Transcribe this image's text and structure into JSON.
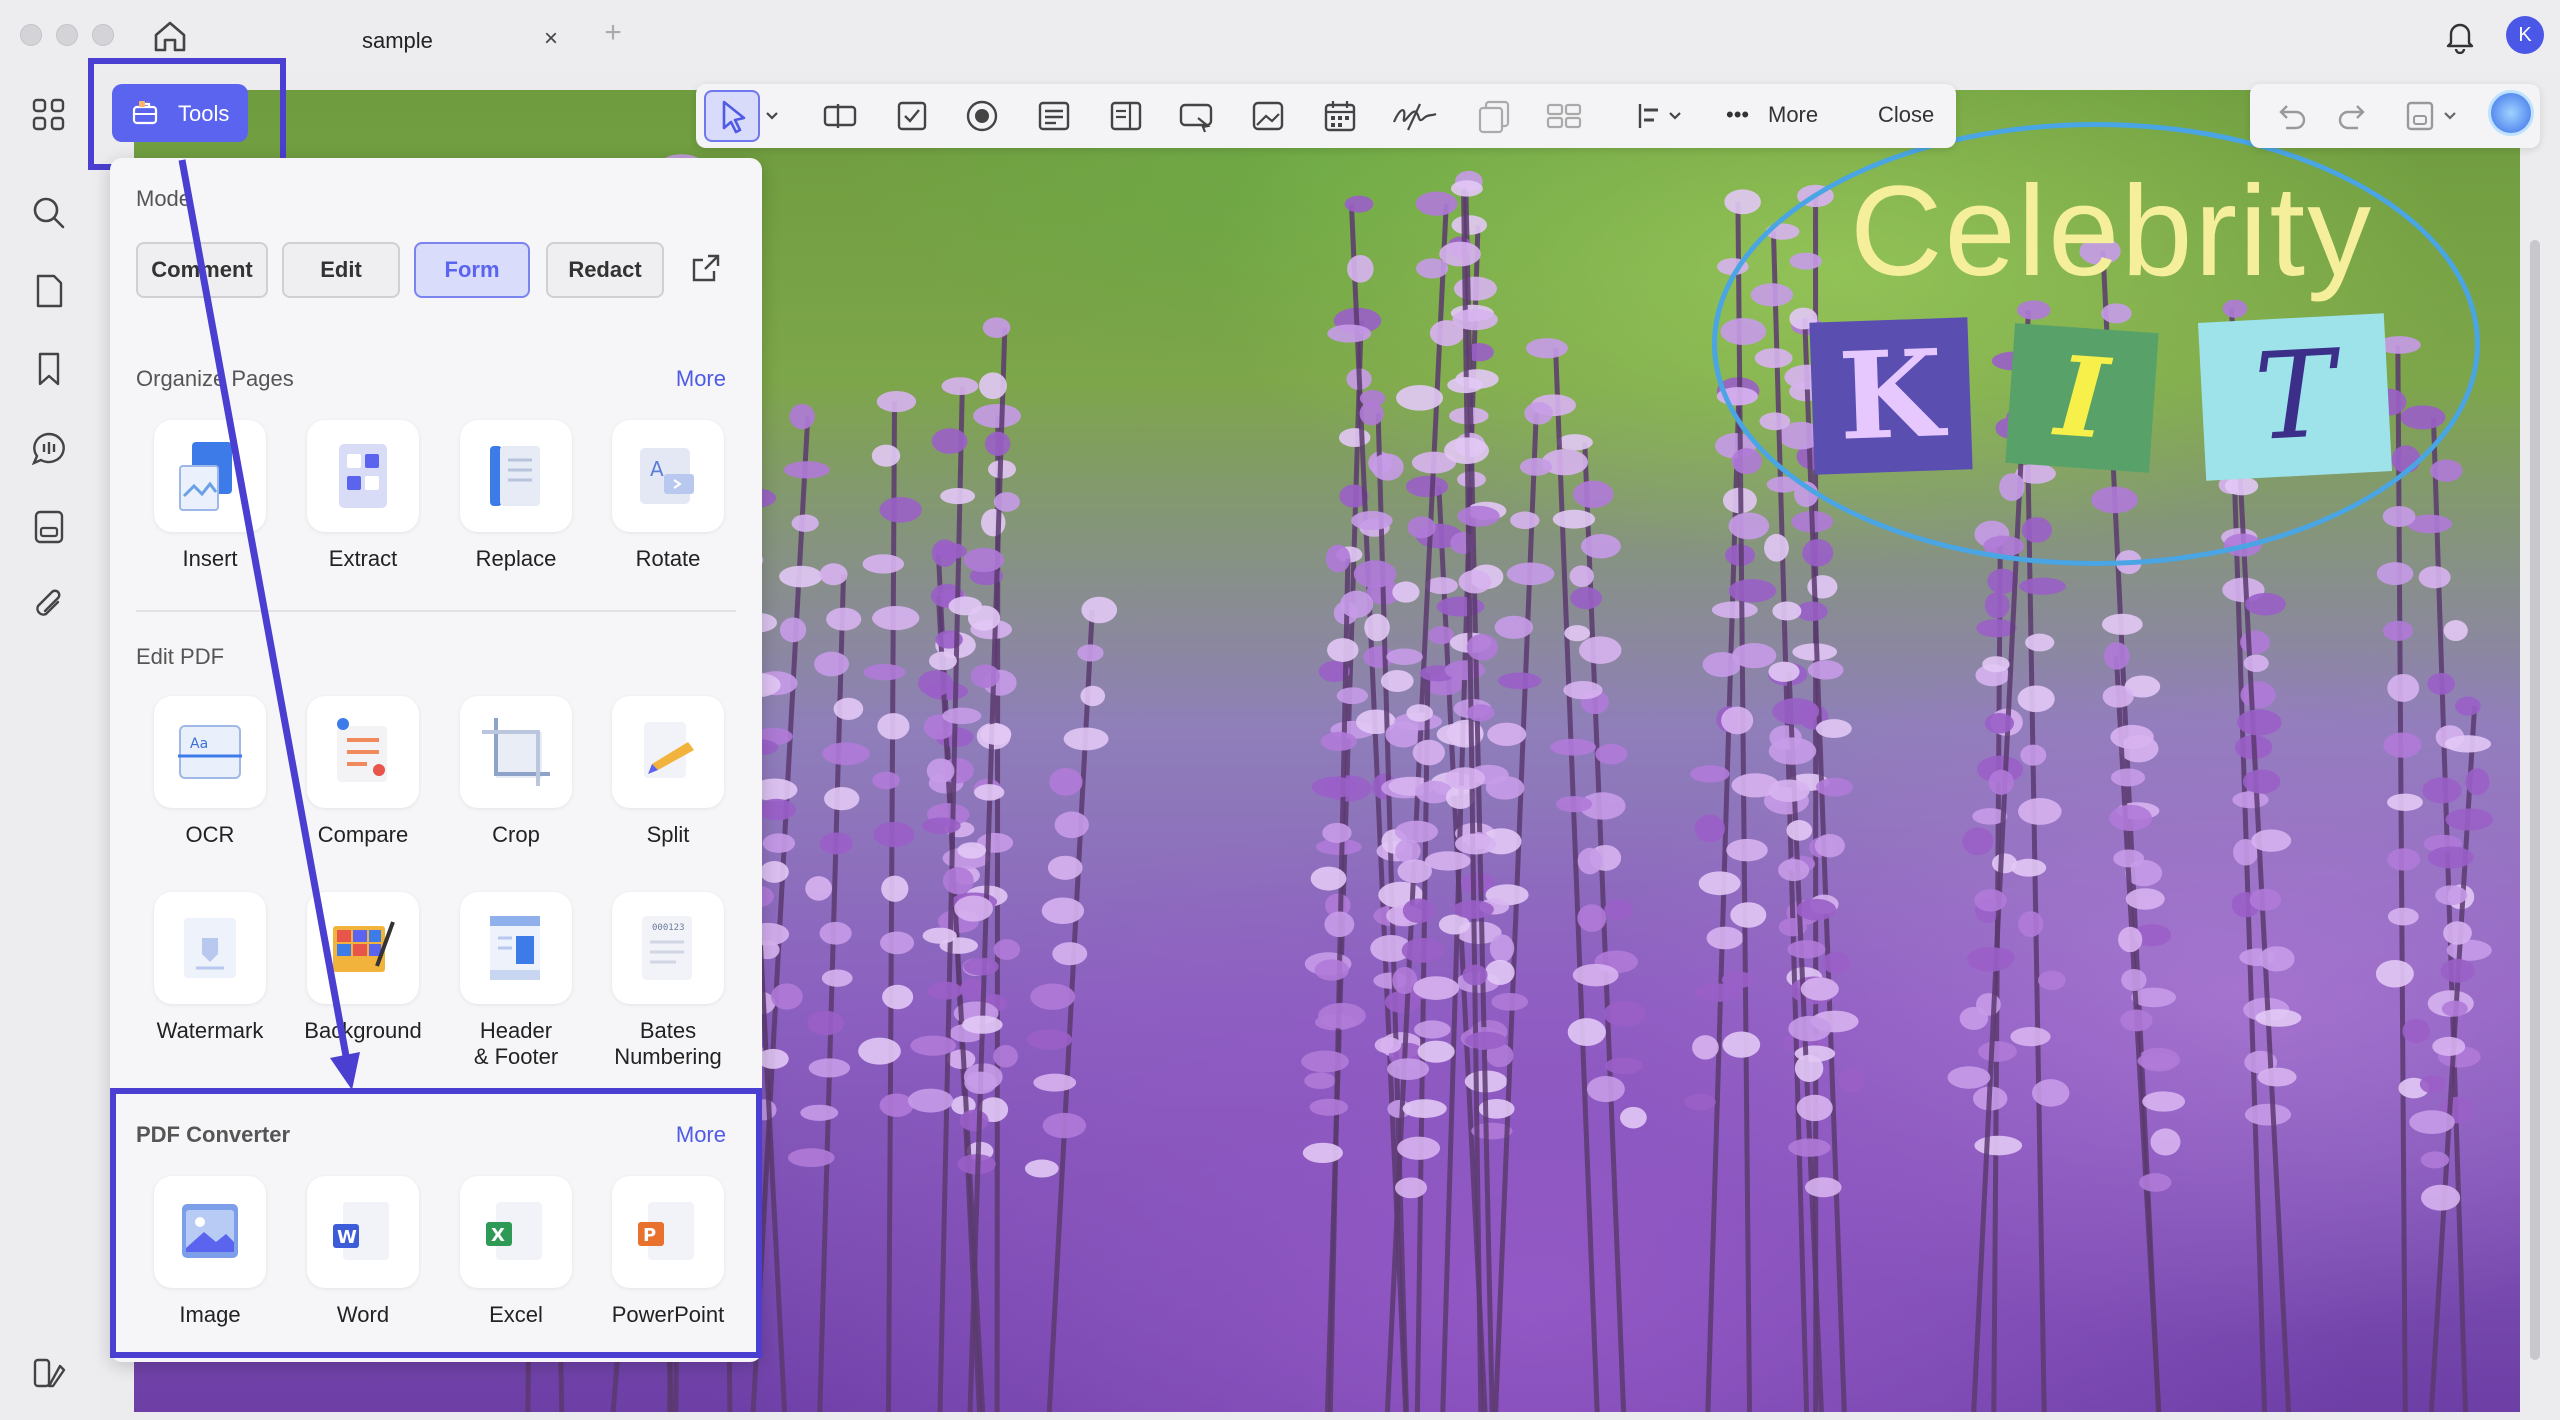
{
  "window": {
    "tab_title": "sample",
    "tab_close": "×",
    "tab_add": "+",
    "avatar_initial": "K"
  },
  "rail": [
    "apps-icon",
    "search-icon",
    "page-icon",
    "bookmark-icon",
    "comment-icon",
    "organize-icon",
    "attachment-icon",
    "sidebar-toggle-icon"
  ],
  "toolbar": {
    "more_label": "More",
    "close_label": "Close",
    "icons": [
      "select-icon",
      "text-field-icon",
      "checkbox-icon",
      "radio-icon",
      "list-box-icon",
      "dropdown-icon",
      "button-icon",
      "image-field-icon",
      "date-field-icon",
      "signature-icon",
      "duplicate-icon",
      "grid-icon",
      "align-icon"
    ]
  },
  "tools_button": {
    "label": "Tools"
  },
  "panel": {
    "mode_title": "Mode",
    "modes": [
      "Comment",
      "Edit",
      "Form",
      "Redact"
    ],
    "active_mode": "Form",
    "organize": {
      "title": "Organize Pages",
      "more": "More",
      "tools": [
        "Insert",
        "Extract",
        "Replace",
        "Rotate"
      ]
    },
    "edit": {
      "title": "Edit PDF",
      "tools_row1": [
        "OCR",
        "Compare",
        "Crop",
        "Split"
      ],
      "tools_row2": [
        "Watermark",
        "Background",
        "Header\n& Footer",
        "Bates\nNumbering"
      ]
    },
    "converter": {
      "title": "PDF Converter",
      "more": "More",
      "tools": [
        "Image",
        "Word",
        "Excel",
        "PowerPoint"
      ]
    }
  },
  "overlay": {
    "title": "Celebrity",
    "letters": [
      "K",
      "I",
      "T"
    ]
  },
  "colors": {
    "accent": "#5b64ee",
    "highlight_box": "#4a3fd0",
    "oval": "#49a5e3"
  }
}
